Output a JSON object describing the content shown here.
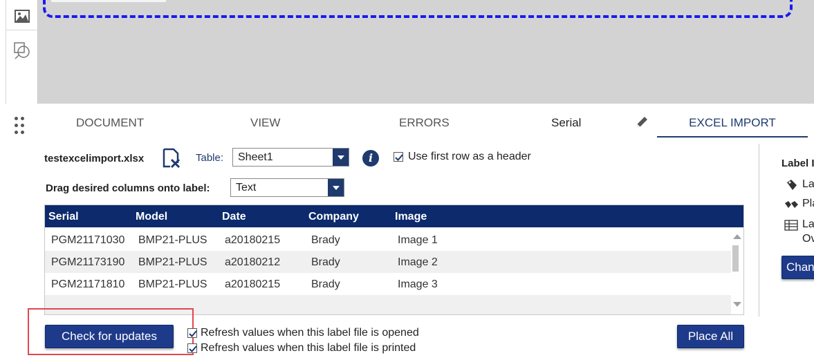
{
  "tabs": {
    "document": "DOCUMENT",
    "view": "VIEW",
    "errors": "ERRORS",
    "serial": "Serial",
    "excel_import": "EXCEL IMPORT"
  },
  "import": {
    "file_name": "testexcelimport.xlsx",
    "table_label": "Table:",
    "table_value": "Sheet1",
    "use_header_label": "Use first row as a header",
    "use_header_checked": true,
    "drag_label": "Drag desired columns onto label:",
    "column_type_value": "Text"
  },
  "grid": {
    "headers": [
      "Serial",
      "Model",
      "Date",
      "Company",
      "Image"
    ],
    "rows": [
      [
        "PGM21171030",
        "BMP21-PLUS",
        "a20180215",
        "Brady",
        "Image 1"
      ],
      [
        "PGM21173190",
        "BMP21-PLUS",
        "a20180212",
        "Brady",
        "Image 2"
      ],
      [
        "PGM21171810",
        "BMP21-PLUS",
        "a20180215",
        "Brady",
        "Image 3"
      ]
    ]
  },
  "actions": {
    "check_updates": "Check for updates",
    "refresh_opened": "Refresh values when this label file is opened",
    "refresh_printed": "Refresh values when this label file is printed",
    "place_all": "Place All"
  },
  "right_panel": {
    "title": "Label I",
    "items": [
      "La",
      "Pla",
      "La",
      "Ov"
    ],
    "button": "Chan"
  },
  "colors": {
    "accent": "#1e3a8a",
    "grid_header": "#0c2a6c",
    "dashed_border": "#1a1af0",
    "highlight": "#e0474c"
  },
  "icons": {
    "toolbar": [
      "image-icon",
      "shape-icon"
    ],
    "excel": "excel-clear-icon",
    "info": "info-icon",
    "edit": "pencil-icon"
  }
}
